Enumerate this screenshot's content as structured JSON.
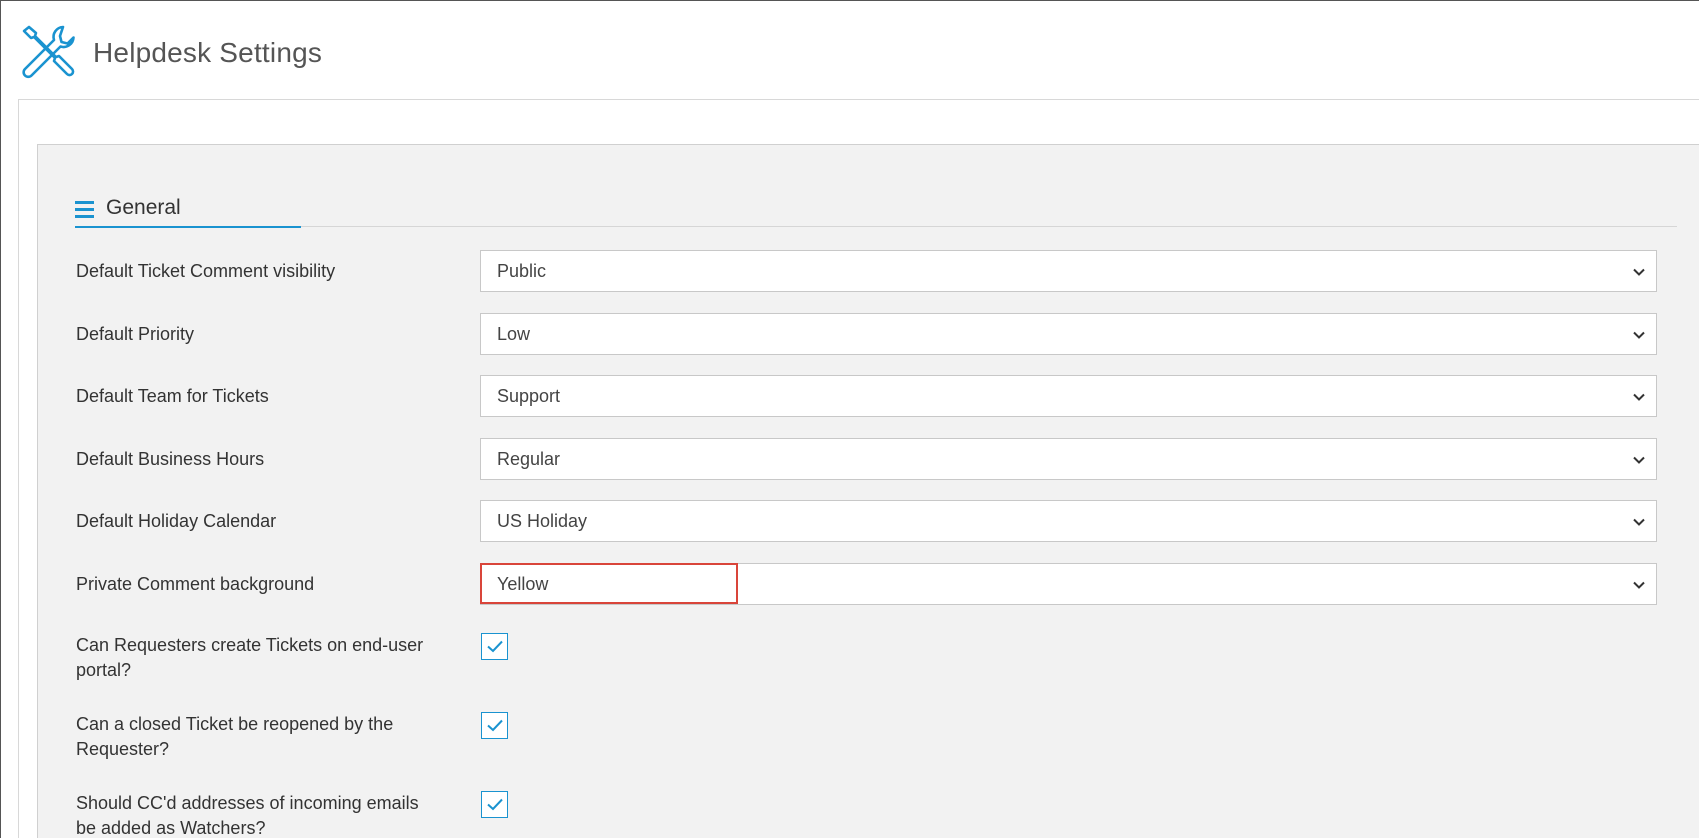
{
  "header": {
    "title": "Helpdesk Settings",
    "icon": "tools-icon"
  },
  "section": {
    "title": "General",
    "icon": "menu-lines-icon"
  },
  "colors": {
    "accent": "#1a93d0",
    "highlight": "#d9453a",
    "panel_background": "#f2f2f2"
  },
  "settings": {
    "comment_visibility": {
      "label": "Default Ticket Comment visibility",
      "value": "Public"
    },
    "priority": {
      "label": "Default Priority",
      "value": "Low"
    },
    "team": {
      "label": "Default Team for Tickets",
      "value": "Support"
    },
    "business_hours": {
      "label": "Default Business Hours",
      "value": "Regular"
    },
    "holiday_calendar": {
      "label": "Default Holiday Calendar",
      "value": "US Holiday"
    },
    "private_comment_bg": {
      "label": "Private Comment background",
      "value": "Yellow"
    }
  },
  "checkboxes": {
    "requesters_create": {
      "label": "Can Requesters create Tickets on end-user portal?",
      "checked": true
    },
    "reopen_closed": {
      "label": "Can a closed Ticket be reopened by the Requester?",
      "checked": true
    },
    "cc_watchers": {
      "label": "Should CC'd addresses of incoming emails be added as Watchers?",
      "checked": true
    }
  }
}
